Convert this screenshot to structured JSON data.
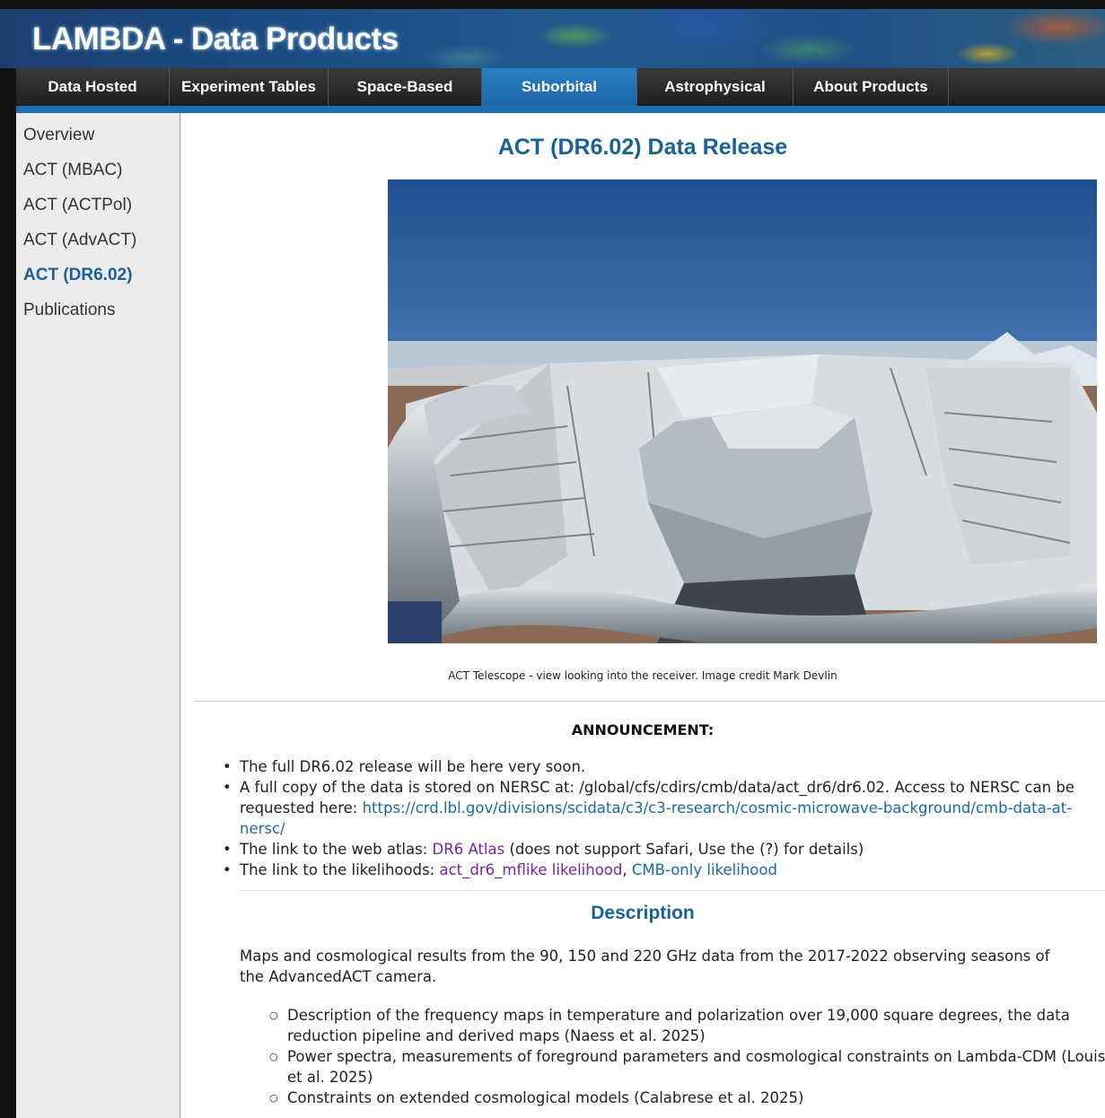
{
  "banner": {
    "title": "LAMBDA - Data Products"
  },
  "nav": {
    "tabs": [
      {
        "label": "Data Hosted"
      },
      {
        "label": "Experiment Tables"
      },
      {
        "label": "Space-Based"
      },
      {
        "label": "Suborbital"
      },
      {
        "label": "Astrophysical"
      },
      {
        "label": "About Products"
      }
    ],
    "active_tab": "Suborbital"
  },
  "sidebar": {
    "items": [
      {
        "label": "Overview"
      },
      {
        "label": "ACT (MBAC)"
      },
      {
        "label": "ACT (ACTPol)"
      },
      {
        "label": "ACT (AdvACT)"
      },
      {
        "label": "ACT (DR6.02)"
      },
      {
        "label": "Publications"
      }
    ],
    "active_item": "ACT (DR6.02)"
  },
  "main": {
    "title": "ACT (DR6.02) Data Release",
    "caption": "ACT Telescope - view looking into the receiver. Image credit Mark Devlin",
    "announcement": {
      "heading": "ANNOUNCEMENT:",
      "b1": "The full DR6.02 release will be here very soon.",
      "b2_text": "A full copy of the data is stored on NERSC at: /global/cfs/cdirs/cmb/data/act_dr6/dr6.02. Access to NERSC can be requested here: ",
      "b2_link": "https://crd.lbl.gov/divisions/scidata/c3/c3-research/cosmic-microwave-background/cmb-data-at-nersc/",
      "b3_pre": "The link to the web atlas: ",
      "b3_link": "DR6 Atlas",
      "b3_post": " (does not support Safari, Use the (?) for details)",
      "b4_pre": "The link to the likelihoods: ",
      "b4_link1": "act_dr6_mflike likelihood",
      "b4_sep": ", ",
      "b4_link2": "CMB-only likelihood"
    },
    "description": {
      "heading": "Description",
      "paragraph": "Maps and cosmological results from the 90, 150 and 220 GHz data from the 2017-2022 observing seasons of the AdvancedACT camera.",
      "items": [
        "Description of the frequency maps in temperature and polarization over 19,000 square degrees, the data reduction pipeline and derived maps (Naess et al. 2025)",
        "Power spectra, measurements of foreground parameters and cosmological constraints on Lambda-CDM (Louis et al. 2025)",
        "Constraints on extended cosmological models (Calabrese et al. 2025)"
      ]
    }
  },
  "colors": {
    "accent_blue": "#1a6296",
    "link": "#1a6aa6",
    "visited_link": "#7a22a8",
    "active_tab": "#1c66a8"
  }
}
